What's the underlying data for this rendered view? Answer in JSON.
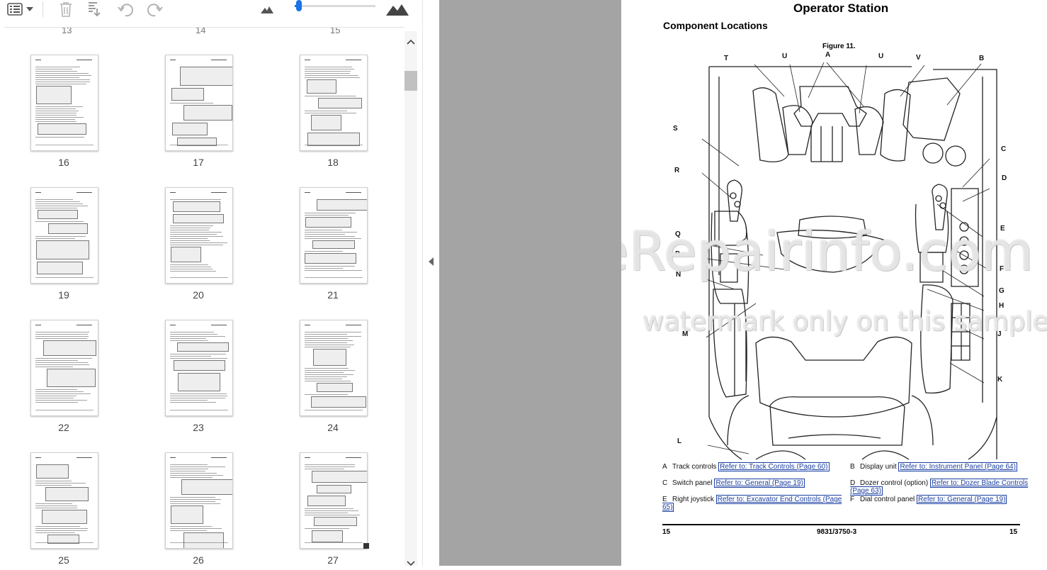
{
  "toolbar": {
    "items": [
      "thumbnail-view-icon",
      "dropdown-icon",
      "delete-icon",
      "print-icon",
      "undo-icon",
      "redo-icon",
      "zoom-out-icon",
      "zoom-slider",
      "zoom-in-icon"
    ],
    "zoom_level": 0.05
  },
  "thumbnails": {
    "top_partial_numbers": [
      "13",
      "14",
      "15"
    ],
    "pages": [
      {
        "number": "16"
      },
      {
        "number": "17"
      },
      {
        "number": "18"
      },
      {
        "number": "19"
      },
      {
        "number": "20"
      },
      {
        "number": "21"
      },
      {
        "number": "22"
      },
      {
        "number": "23"
      },
      {
        "number": "24"
      },
      {
        "number": "25"
      },
      {
        "number": "26"
      },
      {
        "number": "27"
      }
    ]
  },
  "document": {
    "section_title": "Operator Station",
    "subtitle": "Component Locations",
    "figure_caption": "Figure 11.",
    "callouts": [
      "T",
      "U",
      "A",
      "U",
      "V",
      "B",
      "S",
      "C",
      "R",
      "D",
      "E",
      "Q",
      "P",
      "F",
      "N",
      "G",
      "H",
      "J",
      "M",
      "K",
      "L"
    ],
    "legend": [
      {
        "letter": "A",
        "text": "Track controls",
        "link": "Refer to: Track Controls (Page 60)"
      },
      {
        "letter": "B",
        "text": "Display unit",
        "link": "Refer to: Instrument Panel (Page 64)"
      },
      {
        "letter": "C",
        "text": "Switch panel",
        "link": "Refer to: General (Page 19)"
      },
      {
        "letter": "D",
        "text": "Dozer control (option)",
        "link": "Refer to: Dozer Blade Controls (Page 63)"
      },
      {
        "letter": "E",
        "text": "Right joystick",
        "link": "Refer to: Excavator End Controls (Page 65)"
      },
      {
        "letter": "F",
        "text": "Dial control panel",
        "link": "Refer to: General (Page 19)"
      }
    ],
    "footer_left": "15",
    "footer_center": "9831/3750-3",
    "footer_right": "15",
    "watermark_1": "eRepairinfo.com",
    "watermark_2": "watermark only on this sample"
  },
  "colors": {
    "page_gap": "#a4a4a4",
    "link": "#1a3fa0"
  }
}
